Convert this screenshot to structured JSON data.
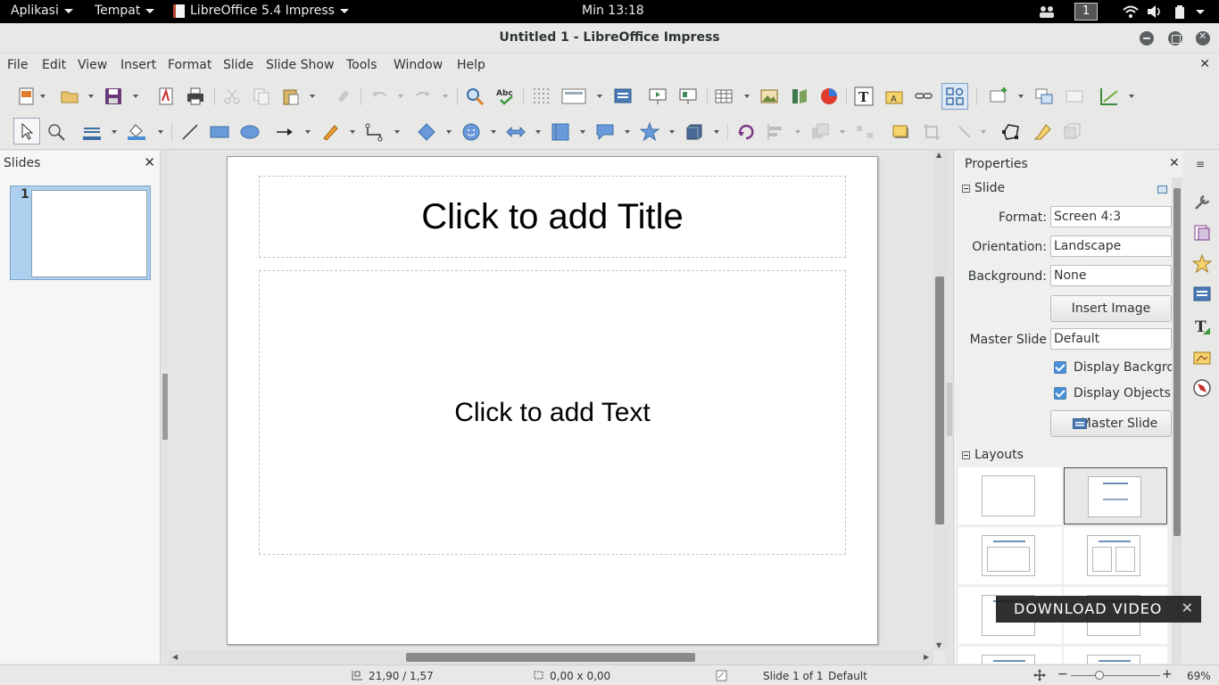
{
  "topbar": {
    "activities": "Aplikasi",
    "places": "Tempat",
    "app_menu": "LibreOffice 5.4 Impress",
    "clock": "Min 13:18",
    "workspace": "1"
  },
  "window": {
    "title": "Untitled 1 - LibreOffice Impress"
  },
  "menu": [
    "File",
    "Edit",
    "View",
    "Insert",
    "Format",
    "Slide",
    "Slide Show",
    "Tools",
    "Window",
    "Help"
  ],
  "slides_pane": {
    "title": "Slides",
    "slide_number": "1"
  },
  "slide": {
    "title_placeholder": "Click to add Title",
    "text_placeholder": "Click to add Text"
  },
  "sidebar": {
    "title": "Properties",
    "slide_section": "Slide",
    "format_label": "Format:",
    "format_value": "Screen 4:3",
    "orientation_label": "Orientation:",
    "orientation_value": "Landscape",
    "background_label": "Background:",
    "background_value": "None",
    "insert_image": "Insert Image",
    "master_slide_label": "Master Slide",
    "master_slide_value": "Default",
    "display_background": "Display Backgrou",
    "display_objects": "Display Objects",
    "master_slide_button": "Master Slide",
    "layouts_section": "Layouts"
  },
  "overlay": {
    "label": "DOWNLOAD VIDEO"
  },
  "statusbar": {
    "position": "21,90 / 1,57",
    "size": "0,00 x 0,00",
    "slide_info": "Slide 1 of 1",
    "master": "Default",
    "zoom": "69%"
  },
  "colors": {
    "accent": "#4a90d9",
    "selection": "#acd0ee"
  }
}
